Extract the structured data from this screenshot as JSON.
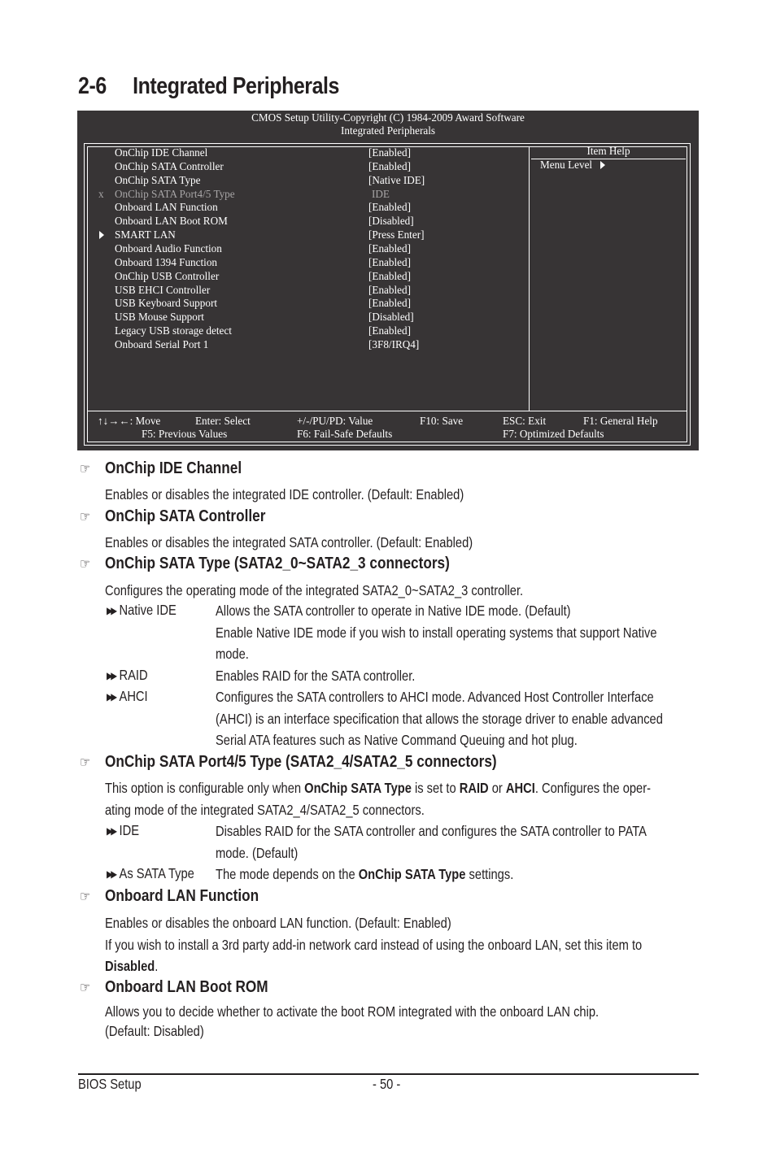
{
  "page": {
    "section_number": "2-6",
    "section_title": "Integrated Peripherals"
  },
  "bios": {
    "header_line1": "CMOS Setup Utility-Copyright (C) 1984-2009 Award Software",
    "header_line2": "Integrated Peripherals",
    "items": [
      {
        "label": "OnChip IDE Channel",
        "value": "[Enabled]",
        "marker": "",
        "disabled": false
      },
      {
        "label": "OnChip SATA Controller",
        "value": "[Enabled]",
        "marker": "",
        "disabled": false
      },
      {
        "label": "OnChip SATA Type",
        "value": "[Native IDE]",
        "marker": "",
        "disabled": false
      },
      {
        "label": "OnChip SATA Port4/5 Type",
        "value": "IDE",
        "marker": "x",
        "disabled": true
      },
      {
        "label": "Onboard LAN Function",
        "value": "[Enabled]",
        "marker": "",
        "disabled": false
      },
      {
        "label": "Onboard LAN Boot ROM",
        "value": "[Disabled]",
        "marker": "",
        "disabled": false
      },
      {
        "label": "SMART LAN",
        "value": "[Press Enter]",
        "marker": "submenu-arrow",
        "disabled": false
      },
      {
        "label": "Onboard Audio Function",
        "value": "[Enabled]",
        "marker": "",
        "disabled": false
      },
      {
        "label": "Onboard 1394 Function",
        "value": "[Enabled]",
        "marker": "",
        "disabled": false
      },
      {
        "label": "OnChip USB Controller",
        "value": "[Enabled]",
        "marker": "",
        "disabled": false
      },
      {
        "label": "USB EHCI Controller",
        "value": "[Enabled]",
        "marker": "",
        "disabled": false
      },
      {
        "label": "USB Keyboard Support",
        "value": "[Enabled]",
        "marker": "",
        "disabled": false
      },
      {
        "label": "USB Mouse Support",
        "value": "[Disabled]",
        "marker": "",
        "disabled": false
      },
      {
        "label": "Legacy USB storage detect",
        "value": "[Enabled]",
        "marker": "",
        "disabled": false
      },
      {
        "label": "Onboard Serial Port 1",
        "value": "[3F8/IRQ4]",
        "marker": "",
        "disabled": false
      }
    ],
    "help_panel": {
      "title": "Item Help",
      "menu_level_label": "Menu Level"
    },
    "keys": {
      "move": "↑↓→←: Move",
      "select": "Enter: Select",
      "value": "+/-/PU/PD: Value",
      "save": "F10: Save",
      "exit": "ESC: Exit",
      "help": "F1: General Help",
      "previous": "F5: Previous Values",
      "failsafe": "F6: Fail-Safe Defaults",
      "optimized": "F7: Optimized Defaults"
    }
  },
  "sections": {
    "ide_channel": {
      "title": "OnChip IDE Channel",
      "text": "Enables or disables the integrated IDE controller. (Default: Enabled)"
    },
    "sata_controller": {
      "title": "OnChip SATA Controller",
      "text": "Enables or disables the integrated SATA controller. (Default: Enabled)"
    },
    "sata_type": {
      "title": "OnChip SATA Type (SATA2_0~SATA2_3 connectors)",
      "text": "Configures the operating mode of the integrated SATA2_0~SATA2_3 controller.",
      "options": [
        {
          "name": "Native IDE",
          "lines": [
            "Allows the SATA controller to operate in Native IDE mode. (Default)",
            "Enable Native IDE mode if you wish to install operating systems that support Native",
            "mode."
          ]
        },
        {
          "name": "RAID",
          "lines": [
            "Enables RAID for the SATA controller."
          ]
        },
        {
          "name": "AHCI",
          "lines": [
            "Configures the SATA controllers to AHCI mode. Advanced Host Controller Interface",
            "(AHCI) is an interface specification that allows the storage driver to enable advanced",
            "Serial ATA features such as Native Command Queuing and hot plug."
          ]
        }
      ]
    },
    "sata_port45": {
      "title": "OnChip SATA Port4/5 Type (SATA2_4/SATA2_5 connectors)",
      "text_a": "This option is configurable only when ",
      "text_b": "OnChip SATA Type",
      "text_c": " is set to ",
      "text_d": "RAID",
      "text_e": " or ",
      "text_f": "AHCI",
      "text_g": ". Configures the oper-",
      "text_line2": "ating mode of the integrated SATA2_4/SATA2_5 connectors.",
      "options": [
        {
          "name": "IDE",
          "lines": [
            "Disables RAID for the SATA controller and configures the SATA controller to PATA",
            "mode. (Default)"
          ]
        },
        {
          "name": "As SATA Type",
          "pre": "The mode depends on the ",
          "bold": "OnChip SATA Type",
          "post": " settings."
        }
      ]
    },
    "lan_function": {
      "title": "Onboard LAN Function",
      "line1": "Enables or disables the onboard LAN function. (Default: Enabled)",
      "line2": "If you wish to install a 3rd party add-in network card instead of using the onboard LAN, set this item to",
      "line3_bold": "Disabled",
      "line3_end": "."
    },
    "lan_boot_rom": {
      "title": "Onboard LAN Boot ROM",
      "line1": "Allows you to decide whether to activate the boot ROM integrated with the onboard LAN chip.",
      "line2": "(Default: Disabled)"
    }
  },
  "footer": {
    "left": "BIOS Setup",
    "page": "- 50 -"
  },
  "icons": {
    "section_bullet": "pointing-hand",
    "option_bullet": "double-right-arrow",
    "hand_glyph": "☞",
    "arrow_glyph": "▶▶"
  }
}
